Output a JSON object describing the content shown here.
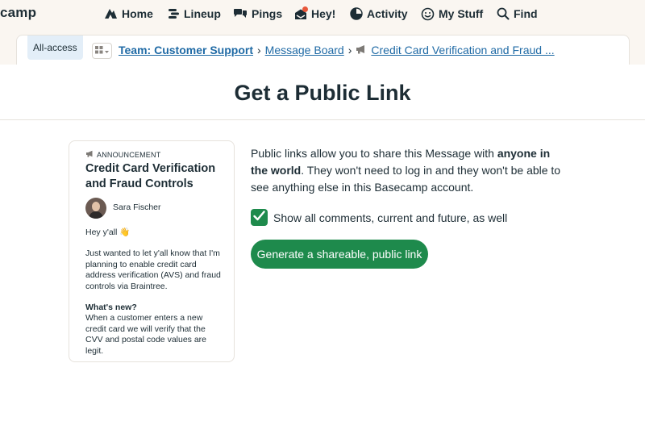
{
  "app": {
    "brand": "camp"
  },
  "nav": {
    "home": "Home",
    "lineup": "Lineup",
    "pings": "Pings",
    "hey": "Hey!",
    "activity": "Activity",
    "mystuff": "My Stuff",
    "find": "Find"
  },
  "breadcrumb": {
    "badge": "All-access",
    "team": "Team: Customer Support",
    "board": "Message Board",
    "message": "Credit Card Verification and Fraud ...",
    "separator": "›"
  },
  "page": {
    "title": "Get a Public Link"
  },
  "preview": {
    "category": "ANNOUNCEMENT",
    "title": "Credit Card Verification and Fraud Controls",
    "author": "Sara Fischer",
    "greeting": "Hey y'all 👋",
    "body": "Just wanted to let y'all know that I'm planning to enable credit card address verification (AVS) and fraud controls via Braintree.",
    "subheading": "What's new?",
    "subtext": "When a customer enters a new credit card we will verify that the CVV and postal code values are legit."
  },
  "share": {
    "desc_before": "Public links allow you to share this Message with ",
    "desc_bold": "anyone in the world",
    "desc_after": ". They won't need to log in and they won't be able to see anything else in this Basecamp account.",
    "checkbox_label": "Show all comments, current and future, as well",
    "checkbox_checked": true,
    "button_label": "Generate a shareable, public link"
  },
  "colors": {
    "accent_green": "#1e8a4c",
    "link_blue": "#1f6aa5",
    "notification": "#e8573a"
  }
}
